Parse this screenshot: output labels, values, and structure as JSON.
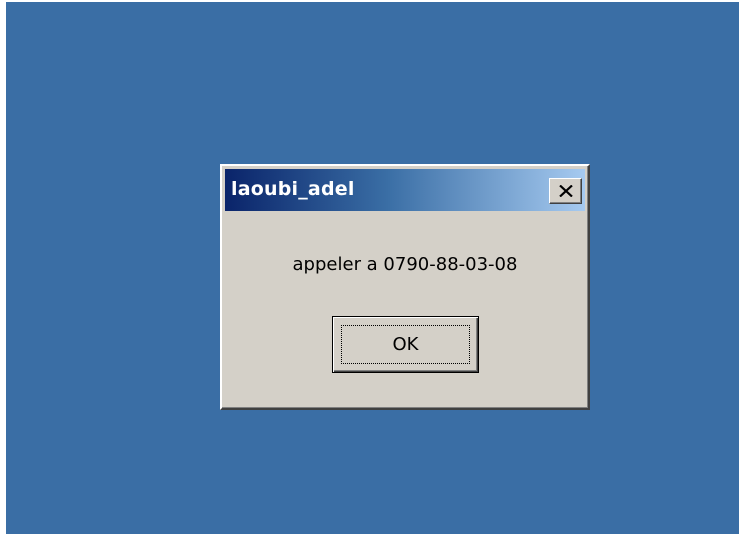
{
  "desktop": {
    "background_color": "#3a6ea5"
  },
  "dialog": {
    "title": "laoubi_adel",
    "message": "appeler a 0790-88-03-08",
    "ok_label": "OK",
    "close_icon": "close-icon"
  },
  "colors": {
    "dialog_face": "#d4d0c8",
    "title_gradient_start": "#0a246a",
    "title_gradient_end": "#a6caf0",
    "title_text": "#ffffff"
  }
}
